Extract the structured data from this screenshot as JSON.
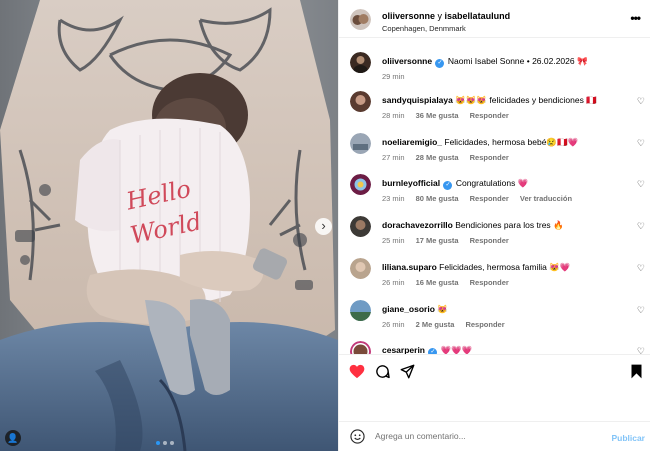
{
  "post": {
    "author": "oliiversonne",
    "connector": "y",
    "coauthor": "isabellataulund",
    "location": "Copenhagen, Denmmark"
  },
  "media": {
    "onesie_text_line1": "Hello",
    "onesie_text_line2": "World",
    "carousel_count": 3,
    "carousel_active": 1
  },
  "caption": {
    "username": "oliiversonne",
    "text": "Naomi Isabel Sonne • 26.02.2026 🎀",
    "time": "29 min"
  },
  "comments": [
    {
      "username": "sandyquispialaya",
      "verified": false,
      "text": "😻😻😻 felicidades y bendiciones 🇵🇪",
      "time": "28 min",
      "likes": "36 Me gusta",
      "reply": "Responder",
      "avatar_color": "#5a3b30"
    },
    {
      "username": "noeliaremigio_",
      "verified": false,
      "text": "Felicidades, hermosa bebé😢🇵🇪💗",
      "time": "27 min",
      "likes": "28 Me gusta",
      "reply": "Responder",
      "avatar_color": "#9aa6b5"
    },
    {
      "username": "burnleyofficial",
      "verified": true,
      "text": "Congratulations 💗",
      "time": "23 min",
      "likes": "80 Me gusta",
      "reply": "Responder",
      "translate": "Ver traducción",
      "avatar_color": "#6c1d45"
    },
    {
      "username": "dorachavezorrillo",
      "verified": false,
      "text": "Bendiciones para los tres 🔥",
      "time": "25 min",
      "likes": "17 Me gusta",
      "reply": "Responder",
      "avatar_color": "#3d3a36"
    },
    {
      "username": "liliana.suparo",
      "verified": false,
      "text": "Felicidades, hermosa familia 😻💗",
      "time": "26 min",
      "likes": "16 Me gusta",
      "reply": "Responder",
      "avatar_color": "#b9a48e"
    },
    {
      "username": "giane_osorio",
      "verified": false,
      "text": "😻",
      "time": "26 min",
      "likes": "2 Me gusta",
      "reply": "Responder",
      "avatar_color": "#6f9bc4"
    },
    {
      "username": "cesarperin",
      "verified": true,
      "text": "💗💗💗",
      "time": "",
      "likes": "",
      "reply": "",
      "avatar_color": "#7a4a3a"
    }
  ],
  "composer": {
    "placeholder": "Agrega un comentario...",
    "post_label": "Publicar"
  },
  "colors": {
    "like_red": "#ff3040",
    "verified_blue": "#3897f0",
    "post_button": "#82c4f8"
  }
}
